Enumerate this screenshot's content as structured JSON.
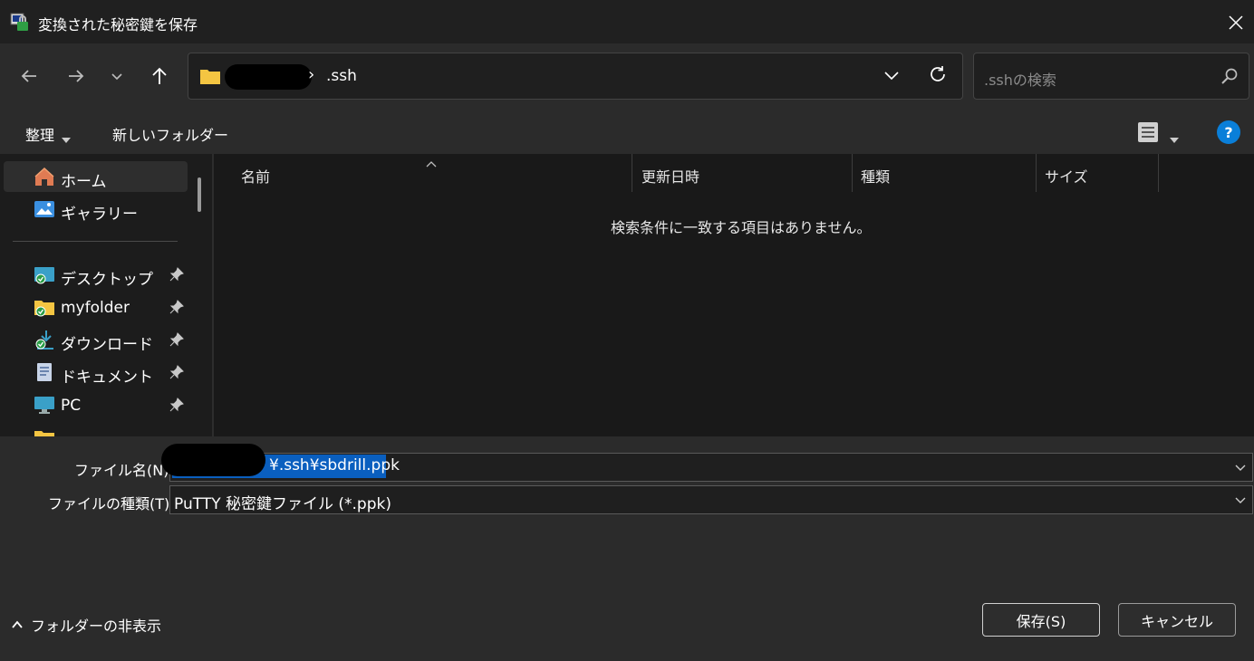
{
  "window": {
    "title": "変換された秘密鍵を保存"
  },
  "address": {
    "current_folder": ".ssh",
    "separator": "›"
  },
  "search": {
    "placeholder": ".sshの検索"
  },
  "command_bar": {
    "organize": "整理",
    "new_folder": "新しいフォルダー"
  },
  "sidebar": {
    "quick": [
      {
        "label": "ホーム",
        "icon": "home-icon",
        "selected": true
      },
      {
        "label": "ギャラリー",
        "icon": "gallery-icon"
      }
    ],
    "pinned": [
      {
        "label": "デスクトップ",
        "icon": "desktop-icon"
      },
      {
        "label": "myfolder",
        "icon": "folder-icon"
      },
      {
        "label": "ダウンロード",
        "icon": "download-icon"
      },
      {
        "label": "ドキュメント",
        "icon": "document-icon"
      },
      {
        "label": "PC",
        "icon": "pc-icon"
      }
    ]
  },
  "file_list": {
    "columns": [
      "名前",
      "更新日時",
      "種類",
      "サイズ"
    ],
    "empty_message": "検索条件に一致する項目はありません。"
  },
  "form": {
    "filename_label": "ファイル名(N):",
    "filename_value": "¥.ssh¥sbdrill.ppk",
    "filetype_label": "ファイルの種類(T):",
    "filetype_value": "PuTTY 秘密鍵ファイル (*.ppk)"
  },
  "footer": {
    "hide_folders": "フォルダーの非表示",
    "save_button": "保存(S)",
    "cancel_button": "キャンセル"
  },
  "colors": {
    "accent": "#0a5fbf",
    "help": "#0a7fd9",
    "folder": "#f4c542"
  }
}
